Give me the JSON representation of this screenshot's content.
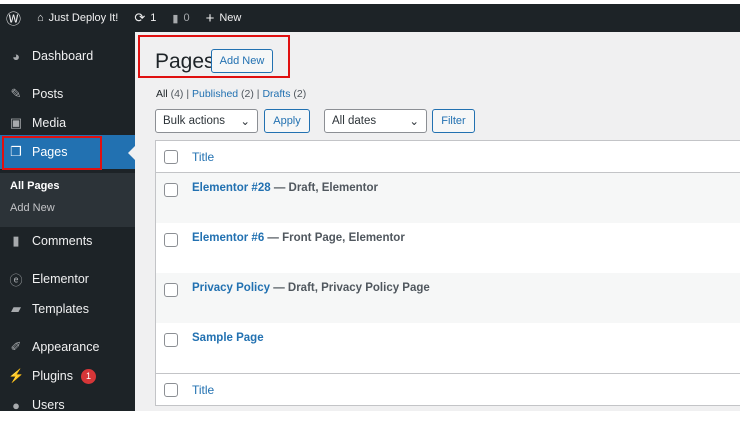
{
  "adminbar": {
    "site": "Just Deploy It!",
    "updates": "1",
    "comments": "0",
    "new": "New"
  },
  "sidebar": {
    "items": [
      {
        "label": "Dashboard",
        "icon": "dashboard-icon"
      },
      {
        "label": "Posts",
        "icon": "pin-icon"
      },
      {
        "label": "Media",
        "icon": "media-icon"
      },
      {
        "label": "Pages",
        "icon": "pages-icon"
      },
      {
        "label": "Comments",
        "icon": "comment-icon"
      },
      {
        "label": "Elementor",
        "icon": "elementor-icon"
      },
      {
        "label": "Templates",
        "icon": "folder-icon"
      },
      {
        "label": "Appearance",
        "icon": "brush-icon"
      },
      {
        "label": "Plugins",
        "icon": "plug-icon",
        "badge": "1"
      },
      {
        "label": "Users",
        "icon": "user-icon"
      }
    ],
    "submenu": [
      "All Pages",
      "Add New"
    ]
  },
  "main": {
    "title": "Pages",
    "add_new": "Add New",
    "filters": {
      "all": "All",
      "all_count": "(4)",
      "published": "Published",
      "published_count": "(2)",
      "drafts": "Drafts",
      "drafts_count": "(2)"
    },
    "bulk_actions": "Bulk actions",
    "apply": "Apply",
    "dates": "All dates",
    "filter": "Filter",
    "column_title": "Title",
    "rows": [
      {
        "title": "Elementor #28",
        "state": " — Draft, Elementor"
      },
      {
        "title": "Elementor #6",
        "state": " — Front Page, Elementor"
      },
      {
        "title": "Privacy Policy",
        "state": " — Draft, Privacy Policy Page"
      },
      {
        "title": "Sample Page",
        "state": ""
      }
    ]
  },
  "colors": {
    "accent": "#2271b1",
    "sidebar": "#1d2327",
    "highlight": "#e01010"
  }
}
